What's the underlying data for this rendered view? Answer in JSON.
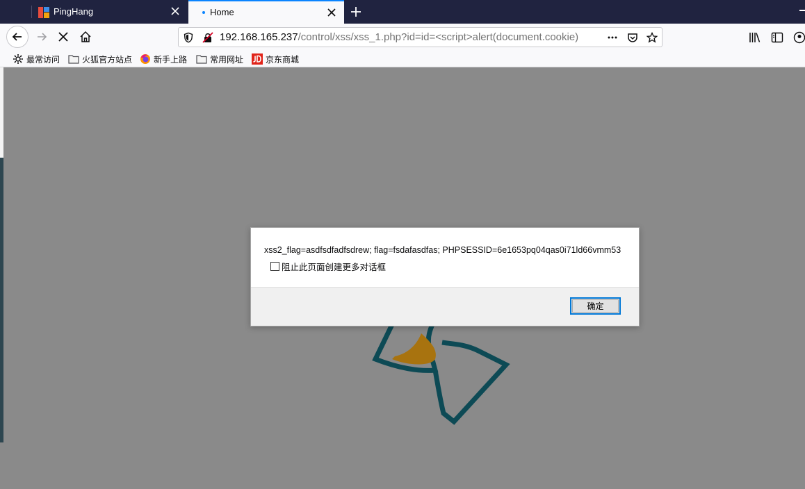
{
  "tabs": [
    {
      "title": "PingHang",
      "active": false
    },
    {
      "title": "Home",
      "active": true
    }
  ],
  "url": {
    "host": "192.168.165.237",
    "path": "/control/xss/xss_1.php?id=id=<script>alert(document.cookie)"
  },
  "bookmarks": [
    {
      "label": "最常访问",
      "icon": "gear-icon"
    },
    {
      "label": "火狐官方站点",
      "icon": "folder-icon"
    },
    {
      "label": "新手上路",
      "icon": "firefox-icon"
    },
    {
      "label": "常用网址",
      "icon": "folder-icon"
    },
    {
      "label": "京东商城",
      "icon": "jd-icon"
    }
  ],
  "dialog": {
    "message": "xss2_flag=asdfsdfadfsdrew; flag=fsdafasdfas; PHPSESSID=6e1653pq04qas0i71ld66vmm53",
    "checkbox_label": "阻止此页面创建更多对话框",
    "checkbox_checked": false,
    "ok_label": "确定"
  },
  "colors": {
    "tabstrip": "#202340",
    "accent": "#0a84ff",
    "overlay": "#8a8a8a",
    "logo_teal": "#0d4a55",
    "logo_gold": "#a8730f"
  }
}
